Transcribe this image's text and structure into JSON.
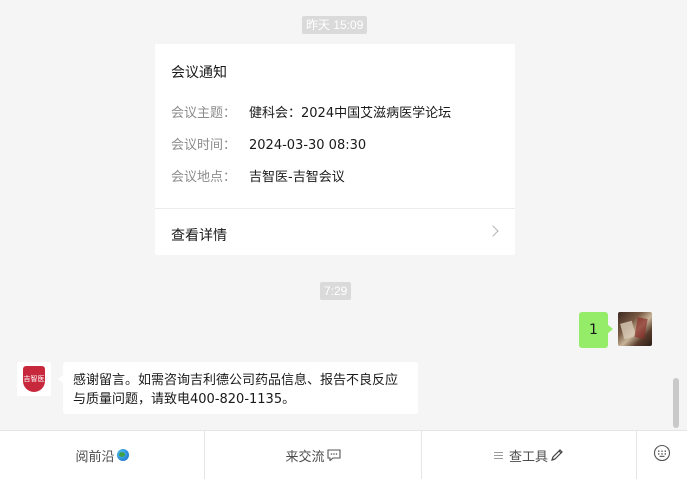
{
  "timestamps": {
    "first": "昨天 15:09",
    "second": "7:29"
  },
  "meeting_card": {
    "title": "会议通知",
    "rows": [
      {
        "label": "会议主题：",
        "value": "健科会：2024中国艾滋病医学论坛"
      },
      {
        "label": "会议时间：",
        "value": "2024-03-30 08:30"
      },
      {
        "label": "会议地点：",
        "value": "吉智医-吉智会议"
      }
    ],
    "details_link": "查看详情"
  },
  "my_message": {
    "text": "1"
  },
  "bot_message": {
    "text": "感谢留言。如需咨询吉利德公司药品信息、报告不良反应与质量问题，请致电400-820-1135。"
  },
  "bot_avatar_text": "吉智医",
  "menu": {
    "items": [
      {
        "label": "阅前沿",
        "icon": "globe-icon"
      },
      {
        "label": "来交流",
        "icon": "chat-bubble-icon"
      },
      {
        "label": "查工具",
        "icon": "pencil-icon"
      }
    ],
    "keyboard_icon": "keyboard-toggle-icon"
  },
  "colors": {
    "my_bubble": "#95ec69",
    "background": "#f5f5f5",
    "bot_brand": "#c8283c"
  }
}
